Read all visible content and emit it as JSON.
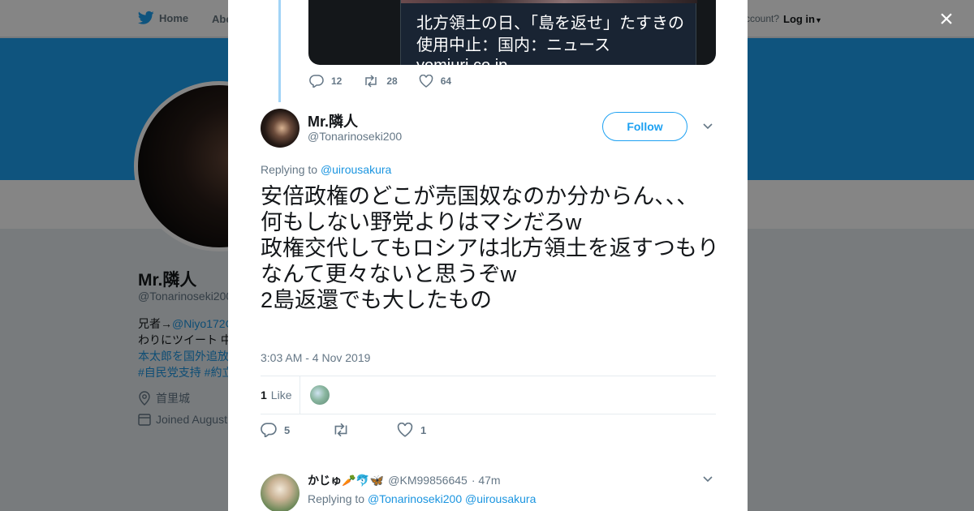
{
  "topnav": {
    "home_label": "Home",
    "about_label": "Abo",
    "account_text": "ccount?",
    "login_label": "Log in"
  },
  "profile": {
    "name": "Mr.隣人",
    "handle": "@Tonarinoseki200",
    "bio_line1_prefix": "兄者→",
    "bio_line1_link": "@Niyo172C",
    "bio_line2": "わりにツイート 中",
    "bio_line3": "本太郎を国外追放",
    "bio_line4": "#自民党支持 #約立",
    "location": "首里城",
    "joined": "Joined August"
  },
  "modal": {
    "close_label": "×",
    "prev_card": {
      "text": "北方領土の日、「島を返せ」たすきの使用中止：国内：ニュース",
      "url_fragment": "yomiuri.co.jp"
    },
    "prev_actions": {
      "replies": "12",
      "retweets": "28",
      "likes": "64"
    },
    "tweet": {
      "name": "Mr.隣人",
      "handle": "@Tonarinoseki200",
      "follow_label": "Follow",
      "replying_label": "Replying to",
      "replying_handle": "@uirousakura",
      "text": "安倍政権のどこが売国奴なのか分からん、、、\n何もしない野党よりはマシだろw\n政権交代してもロシアは北方領土を返すつもりなんて更々ないと思うぞw\n2島返還でも大したもの",
      "timestamp": "3:03 AM - 4 Nov 2019",
      "like_count": "1",
      "like_label": "Like",
      "actions": {
        "replies": "5",
        "retweets": "",
        "likes": "1"
      }
    },
    "reply": {
      "name": "かじゅ🥕🐬🦋",
      "handle": "@KM99856645",
      "time": "· 47m",
      "replying_label": "Replying to",
      "replying_handle1": "@Tonarinoseki200",
      "replying_handle2": "@uirousakura"
    }
  },
  "colors": {
    "accent": "#1da1f2",
    "link": "#1b95e0",
    "secondary_text": "#657786",
    "thread_line": "#a2d4f7"
  }
}
